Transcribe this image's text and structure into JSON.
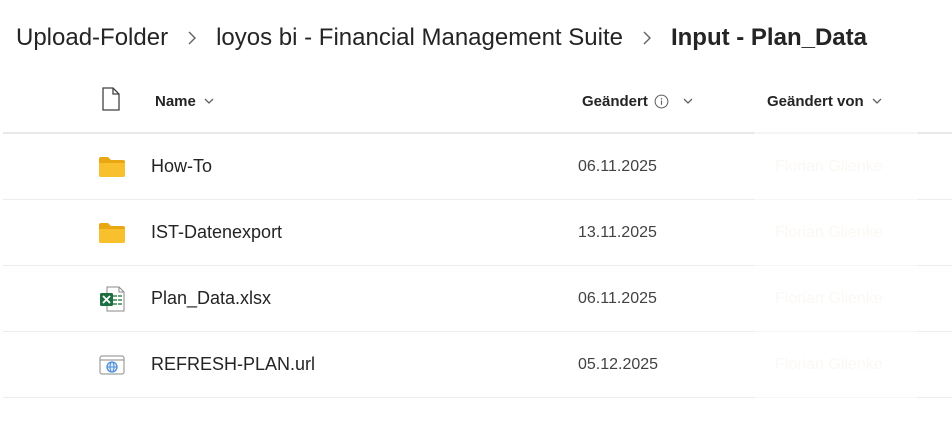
{
  "breadcrumb": {
    "items": [
      {
        "label": "Upload-Folder"
      },
      {
        "label": "loyos bi - Financial Management Suite"
      },
      {
        "label": "Input - Plan_Data"
      }
    ]
  },
  "list": {
    "columns": {
      "name": "Name",
      "modified": "Geändert",
      "modified_by": "Geändert von"
    },
    "rows": [
      {
        "name": "How-To",
        "type_icon": "folder-icon",
        "modified": "06.11.2025",
        "modified_by": "Florian Glienke"
      },
      {
        "name": "IST-Datenexport",
        "type_icon": "folder-icon",
        "modified": "13.11.2025",
        "modified_by": "Florian Glienke"
      },
      {
        "name": "Plan_Data.xlsx",
        "type_icon": "excel-file-icon",
        "modified": "06.11.2025",
        "modified_by": "Florian Glienke"
      },
      {
        "name": "REFRESH-PLAN.url",
        "type_icon": "url-file-icon",
        "modified": "05.12.2025",
        "modified_by": "Florian Glienke"
      }
    ]
  },
  "colors": {
    "folder": "#f8c02d",
    "excel": "#1d6f42",
    "url_accent": "#4f8fd8"
  }
}
